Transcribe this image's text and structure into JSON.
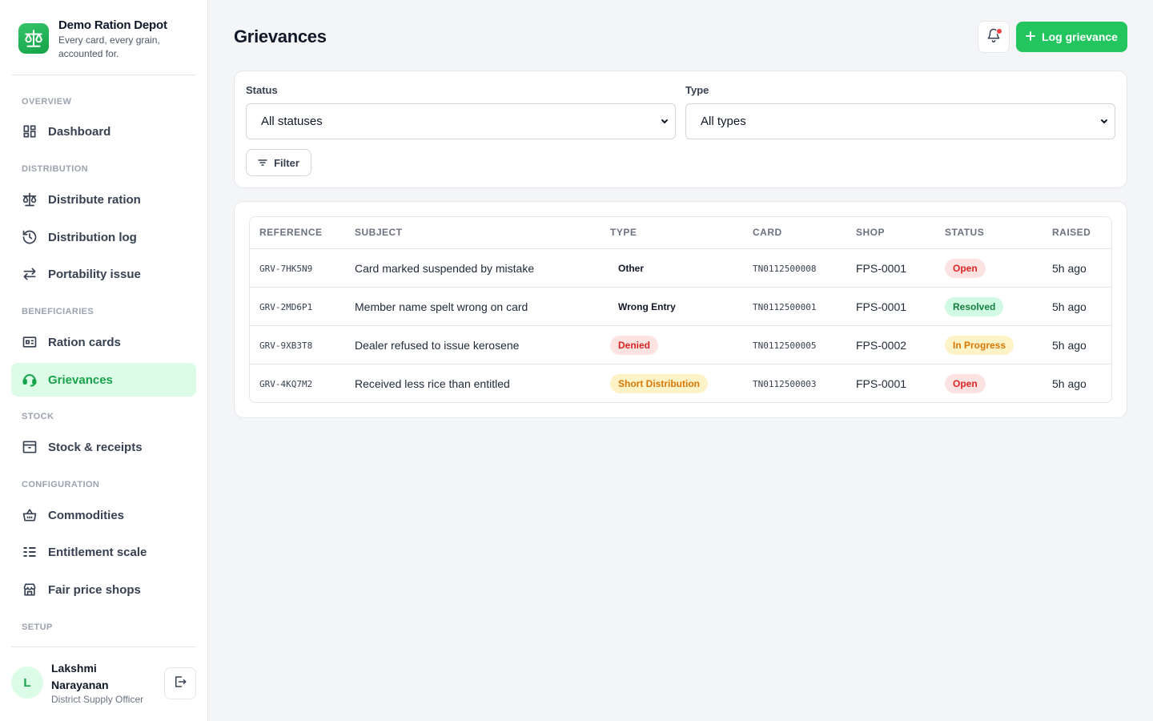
{
  "brand": {
    "title": "Demo Ration Depot",
    "tagline": "Every card, every grain, accounted for."
  },
  "sidebar": {
    "sections": {
      "overview": "OVERVIEW",
      "distribution": "DISTRIBUTION",
      "beneficiaries": "BENEFICIARIES",
      "stock": "STOCK",
      "configuration": "CONFIGURATION",
      "setup": "SETUP"
    },
    "items": {
      "dashboard": "Dashboard",
      "distribute_ration": "Distribute ration",
      "distribution_log": "Distribution log",
      "portability_issue": "Portability issue",
      "ration_cards": "Ration cards",
      "grievances": "Grievances",
      "stock_receipts": "Stock & receipts",
      "commodities": "Commodities",
      "entitlement_scale": "Entitlement scale",
      "fair_price_shops": "Fair price shops"
    },
    "active": "grievances"
  },
  "user": {
    "initial": "L",
    "name": "Lakshmi Narayanan",
    "role": "District Supply Officer"
  },
  "header": {
    "title": "Grievances",
    "primary_button": "Log grievance",
    "has_notification": true
  },
  "filters": {
    "status_label": "Status",
    "status_value": "All statuses",
    "type_label": "Type",
    "type_value": "All types",
    "filter_button": "Filter"
  },
  "table": {
    "columns": {
      "reference": "REFERENCE",
      "subject": "SUBJECT",
      "type": "TYPE",
      "card": "CARD",
      "shop": "SHOP",
      "status": "STATUS",
      "raised": "RAISED"
    },
    "rows": [
      {
        "reference": "GRV-7HK5N9",
        "subject": "Card marked suspended by mistake",
        "type": "Other",
        "card": "TN0112500008",
        "shop": "FPS-0001",
        "status": "Open",
        "raised": "5h ago"
      },
      {
        "reference": "GRV-2MD6P1",
        "subject": "Member name spelt wrong on card",
        "type": "Wrong Entry",
        "card": "TN0112500001",
        "shop": "FPS-0001",
        "status": "Resolved",
        "raised": "5h ago"
      },
      {
        "reference": "GRV-9XB3T8",
        "subject": "Dealer refused to issue kerosene",
        "type": "Denied",
        "card": "TN0112500005",
        "shop": "FPS-0002",
        "status": "In Progress",
        "raised": "5h ago"
      },
      {
        "reference": "GRV-4KQ7M2",
        "subject": "Received less rice than entitled",
        "type": "Short Distribution",
        "card": "TN0112500003",
        "shop": "FPS-0001",
        "status": "Open",
        "raised": "5h ago"
      }
    ]
  },
  "colors": {
    "accent": "#22c55e",
    "accent_dark": "#16a34a",
    "open": "#dc2626",
    "resolved": "#15803d",
    "in_progress": "#d97706"
  }
}
